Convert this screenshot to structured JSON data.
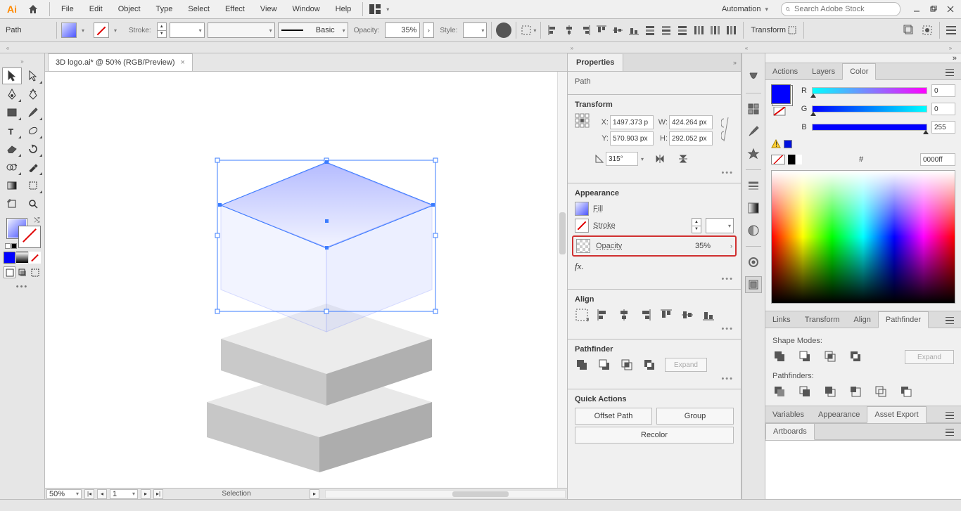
{
  "app": {
    "logo_text": "Ai",
    "menus": [
      "File",
      "Edit",
      "Object",
      "Type",
      "Select",
      "Effect",
      "View",
      "Window",
      "Help"
    ],
    "workspace": "Automation",
    "search_placeholder": "Search Adobe Stock"
  },
  "control": {
    "object_type": "Path",
    "stroke_label": "Stroke:",
    "stroke_weight": "",
    "variable_profile": "",
    "brush_label": "Basic",
    "opacity_label": "Opacity:",
    "opacity_value": "35%",
    "style_label": "Style:",
    "transform_label": "Transform"
  },
  "document": {
    "tab_title": "3D logo.ai* @ 50% (RGB/Preview)",
    "zoom": "50%",
    "artboard_nav": "1",
    "status": "Selection"
  },
  "properties": {
    "tab": "Properties",
    "obj_type": "Path",
    "transform": {
      "title": "Transform",
      "x": "1497.373 p",
      "y": "570.903 px",
      "w": "424.264 px",
      "h": "292.052 px",
      "angle": "315°",
      "x_label": "X:",
      "y_label": "Y:",
      "w_label": "W:",
      "h_label": "H:"
    },
    "appearance": {
      "title": "Appearance",
      "fill_label": "Fill",
      "stroke_label": "Stroke",
      "stroke_weight": "",
      "opacity_label": "Opacity",
      "opacity_value": "35%"
    },
    "align": {
      "title": "Align"
    },
    "pathfinder": {
      "title": "Pathfinder",
      "expand": "Expand"
    },
    "quick": {
      "title": "Quick Actions",
      "offset": "Offset Path",
      "group": "Group",
      "recolor": "Recolor"
    },
    "more": "•••"
  },
  "right": {
    "tabs_color": [
      "Actions",
      "Layers",
      "Color"
    ],
    "active_color_tab": "Color",
    "rgb": {
      "r": "0",
      "g": "0",
      "b": "255",
      "r_lab": "R",
      "g_lab": "G",
      "b_lab": "B"
    },
    "hex_prefix": "#",
    "hex": "0000ff",
    "tabs_pf": [
      "Links",
      "Transform",
      "Align",
      "Pathfinder"
    ],
    "active_pf_tab": "Pathfinder",
    "shape_modes": "Shape Modes:",
    "pathfinders": "Pathfinders:",
    "expand": "Expand",
    "tabs_ae": [
      "Variables",
      "Appearance",
      "Asset Export"
    ],
    "active_ae_tab": "Asset Export",
    "tabs_ab": [
      "Artboards"
    ]
  }
}
